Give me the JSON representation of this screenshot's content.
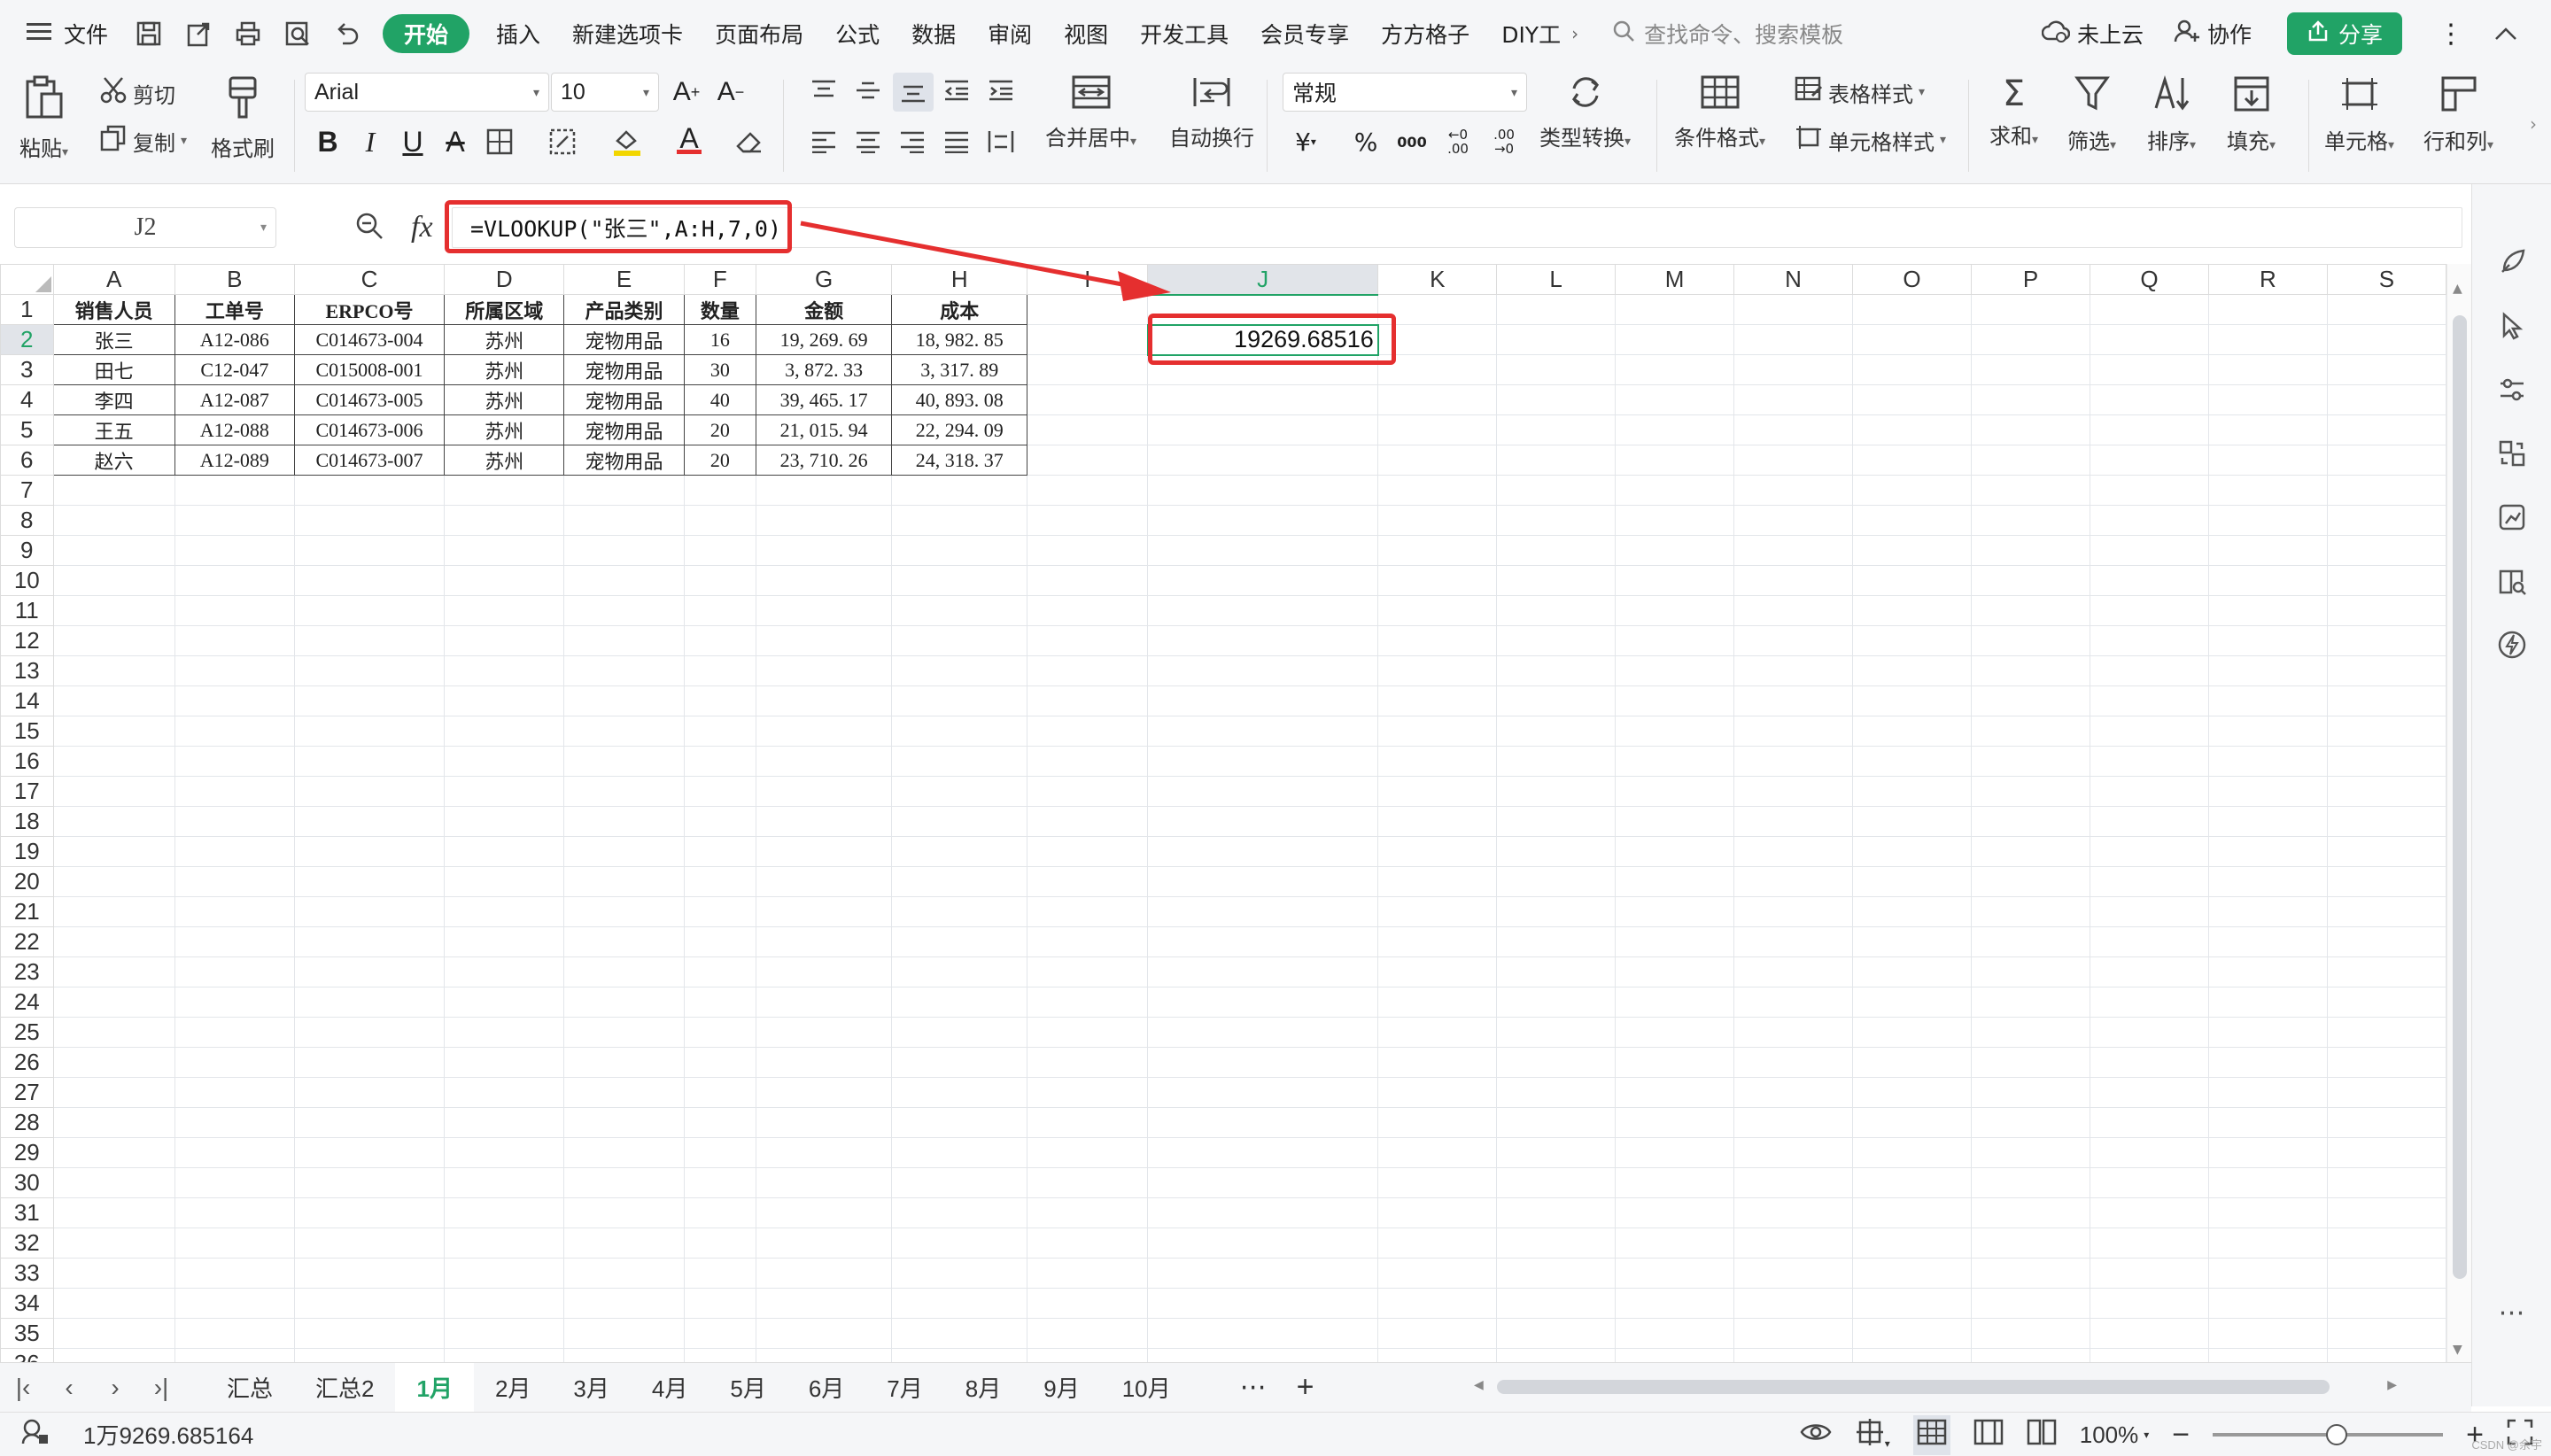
{
  "menubar": {
    "file_label": "文件",
    "tabs": [
      {
        "label": "开始",
        "active": true
      },
      {
        "label": "插入"
      },
      {
        "label": "新建选项卡"
      },
      {
        "label": "页面布局"
      },
      {
        "label": "公式"
      },
      {
        "label": "数据"
      },
      {
        "label": "审阅"
      },
      {
        "label": "视图"
      },
      {
        "label": "开发工具"
      },
      {
        "label": "会员专享"
      },
      {
        "label": "方方格子"
      },
      {
        "label": "DIY工"
      }
    ],
    "search_placeholder": "查找命令、搜索模板",
    "cloud_label": "未上云",
    "collab_label": "协作",
    "share_label": "分享"
  },
  "ribbon": {
    "paste": "粘贴",
    "cut": "剪切",
    "copy": "复制",
    "format_painter": "格式刷",
    "font_name": "Arial",
    "font_size": "10",
    "merge_center": "合并居中",
    "wrap_text": "自动换行",
    "number_format": "常规",
    "type_convert": "类型转换",
    "conditional_format": "条件格式",
    "table_style": "表格样式",
    "cell_style": "单元格样式",
    "sum": "求和",
    "filter": "筛选",
    "sort": "排序",
    "fill": "填充",
    "cell": "单元格",
    "row_col": "行和列"
  },
  "formula_bar": {
    "cell_ref": "J2",
    "fx": "fx",
    "formula": "=VLOOKUP(\"张三\",A:H,7,0)"
  },
  "sheet": {
    "columns": [
      "A",
      "B",
      "C",
      "D",
      "E",
      "F",
      "G",
      "H",
      "I",
      "J",
      "K",
      "L",
      "M",
      "N",
      "O",
      "P",
      "Q",
      "R",
      "S"
    ],
    "row_count": 36,
    "selected_column": "J",
    "selected_row": 2,
    "header_row": [
      "销售人员",
      "工单号",
      "ERPCO号",
      "所属区域",
      "产品类别",
      "数量",
      "金额",
      "成本"
    ],
    "data_rows": [
      [
        "张三",
        "A12-086",
        "C014673-004",
        "苏州",
        "宠物用品",
        "16",
        "19, 269. 69",
        "18, 982. 85"
      ],
      [
        "田七",
        "C12-047",
        "C015008-001",
        "苏州",
        "宠物用品",
        "30",
        "3, 872. 33",
        "3, 317. 89"
      ],
      [
        "李四",
        "A12-087",
        "C014673-005",
        "苏州",
        "宠物用品",
        "40",
        "39, 465. 17",
        "40, 893. 08"
      ],
      [
        "王五",
        "A12-088",
        "C014673-006",
        "苏州",
        "宠物用品",
        "20",
        "21, 015. 94",
        "22, 294. 09"
      ],
      [
        "赵六",
        "A12-089",
        "C014673-007",
        "苏州",
        "宠物用品",
        "20",
        "23, 710. 26",
        "24, 318. 37"
      ]
    ],
    "result_value": "19269.68516"
  },
  "sheet_tabs": [
    "汇总",
    "汇总2",
    "1月",
    "2月",
    "3月",
    "4月",
    "5月",
    "6月",
    "7月",
    "8月",
    "9月",
    "10月"
  ],
  "active_sheet": "1月",
  "statusbar": {
    "value_text": "1万9269.685164",
    "zoom": "100%"
  },
  "watermark": "CSDN @余宇",
  "colors": {
    "accent": "#21a366",
    "annotation": "#e52f2f"
  }
}
